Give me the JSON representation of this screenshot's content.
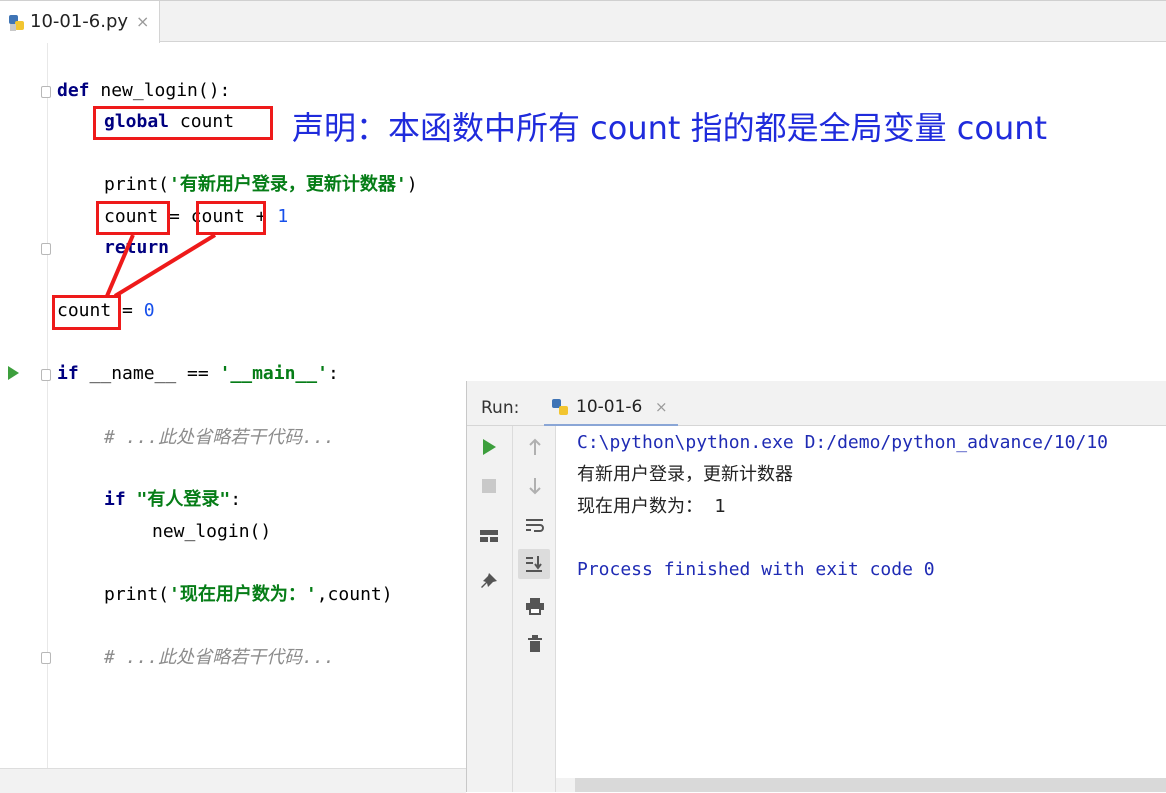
{
  "editor_tab": {
    "filename": "10-01-6.py",
    "close": "×"
  },
  "code": {
    "line1_kw": "def",
    "line1_rest": " new_login():",
    "line2_kw": "global",
    "line2_rest": " count",
    "line3_fn": "print(",
    "line3_str": "'有新用户登录，更新计数器'",
    "line3_end": ")",
    "line4_a": "count",
    "line4_b": " = ",
    "line4_c": "count",
    "line4_d": " + ",
    "line4_num": "1",
    "line5_kw": "return",
    "line6_a": "count",
    "line6_b": " = ",
    "line6_num": "0",
    "line7_kw": "if",
    "line7_mid": " __name__ == ",
    "line7_str": "'__main__'",
    "line7_end": ":",
    "line8_cmt": "# ...此处省略若干代码...",
    "line9_kw": "if",
    "line9_str": " \"有人登录\"",
    "line9_end": ":",
    "line10": "new_login()",
    "line11_fn": "print(",
    "line11_str": "'现在用户数为：'",
    "line11_end": ",count)",
    "line12_cmt": "# ...此处省略若干代码..."
  },
  "annotation": "声明：本函数中所有 count 指的都是全局变量 count",
  "run_panel": {
    "label": "Run:",
    "tab_name": "10-01-6",
    "close": "×",
    "output": [
      "C:\\python\\python.exe D:/demo/python_advance/10/10",
      "有新用户登录，更新计数器",
      "现在用户数为：  1",
      "",
      "Process finished with exit code 0"
    ]
  },
  "colors": {
    "annotation": "#1f2bdc",
    "highlight_box": "#ee1a1a",
    "keyword": "#000080",
    "string": "#067d17",
    "number": "#1750eb"
  }
}
